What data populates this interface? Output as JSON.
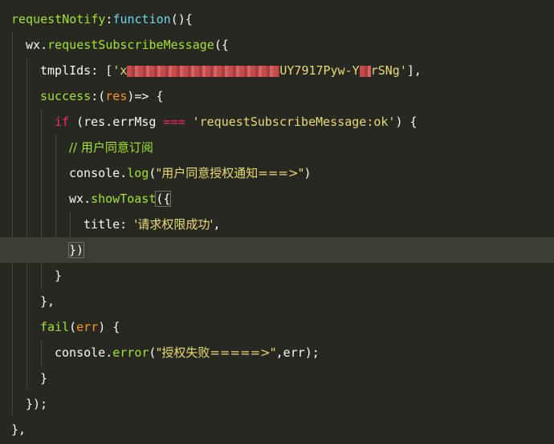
{
  "editor": {
    "lines": {
      "l1": {
        "name": "requestNotify",
        "colon": ":",
        "fn_kw": "function",
        "rest": "(){"
      },
      "l2": {
        "obj": "wx",
        "dot": ".",
        "method": "requestSubscribeMessage",
        "rest": "({"
      },
      "l3": {
        "key": "tmplIds",
        "colon": ": [",
        "q1": "'",
        "visible_a": "x",
        "visible_b": "UY7917Pyw-Y",
        "visible_c": "rSNg",
        "q2": "'",
        "end": "],"
      },
      "l4": {
        "key": "success",
        "colon": ":",
        "paren_open": "(",
        "param": "res",
        "arrow": ")=> {"
      },
      "l5": {
        "kw": "if",
        "open": " (",
        "obj": "res",
        "dot": ".",
        "prop": "errMsg",
        "op": " === ",
        "str": "'requestSubscribeMessage:ok'",
        "close": ") {"
      },
      "l6": {
        "comment": "// 用户同意订阅"
      },
      "l7": {
        "obj": "console",
        "dot": ".",
        "method": "log",
        "open": "(",
        "str": "\"用户同意授权通知===>\"",
        "close": ")"
      },
      "l8": {
        "obj": "wx",
        "dot": ".",
        "method": "showToast",
        "open": "({"
      },
      "l9": {
        "key": "title",
        "colon": ": ",
        "str": "'请求权限成功'",
        "comma": ","
      },
      "l10": {
        "text": "})"
      },
      "l11": {
        "text": "}"
      },
      "l12": {
        "text": "},"
      },
      "l13": {
        "key": "fail",
        "open": "(",
        "param": "err",
        "close": ") {"
      },
      "l14": {
        "obj": "console",
        "dot": ".",
        "method": "error",
        "open": "(",
        "str": "\"授权失败=====>\"",
        "rest": ",err);"
      },
      "l15": {
        "text": "}"
      },
      "l16": {
        "text": "});"
      },
      "l17": {
        "text": "},"
      }
    }
  }
}
